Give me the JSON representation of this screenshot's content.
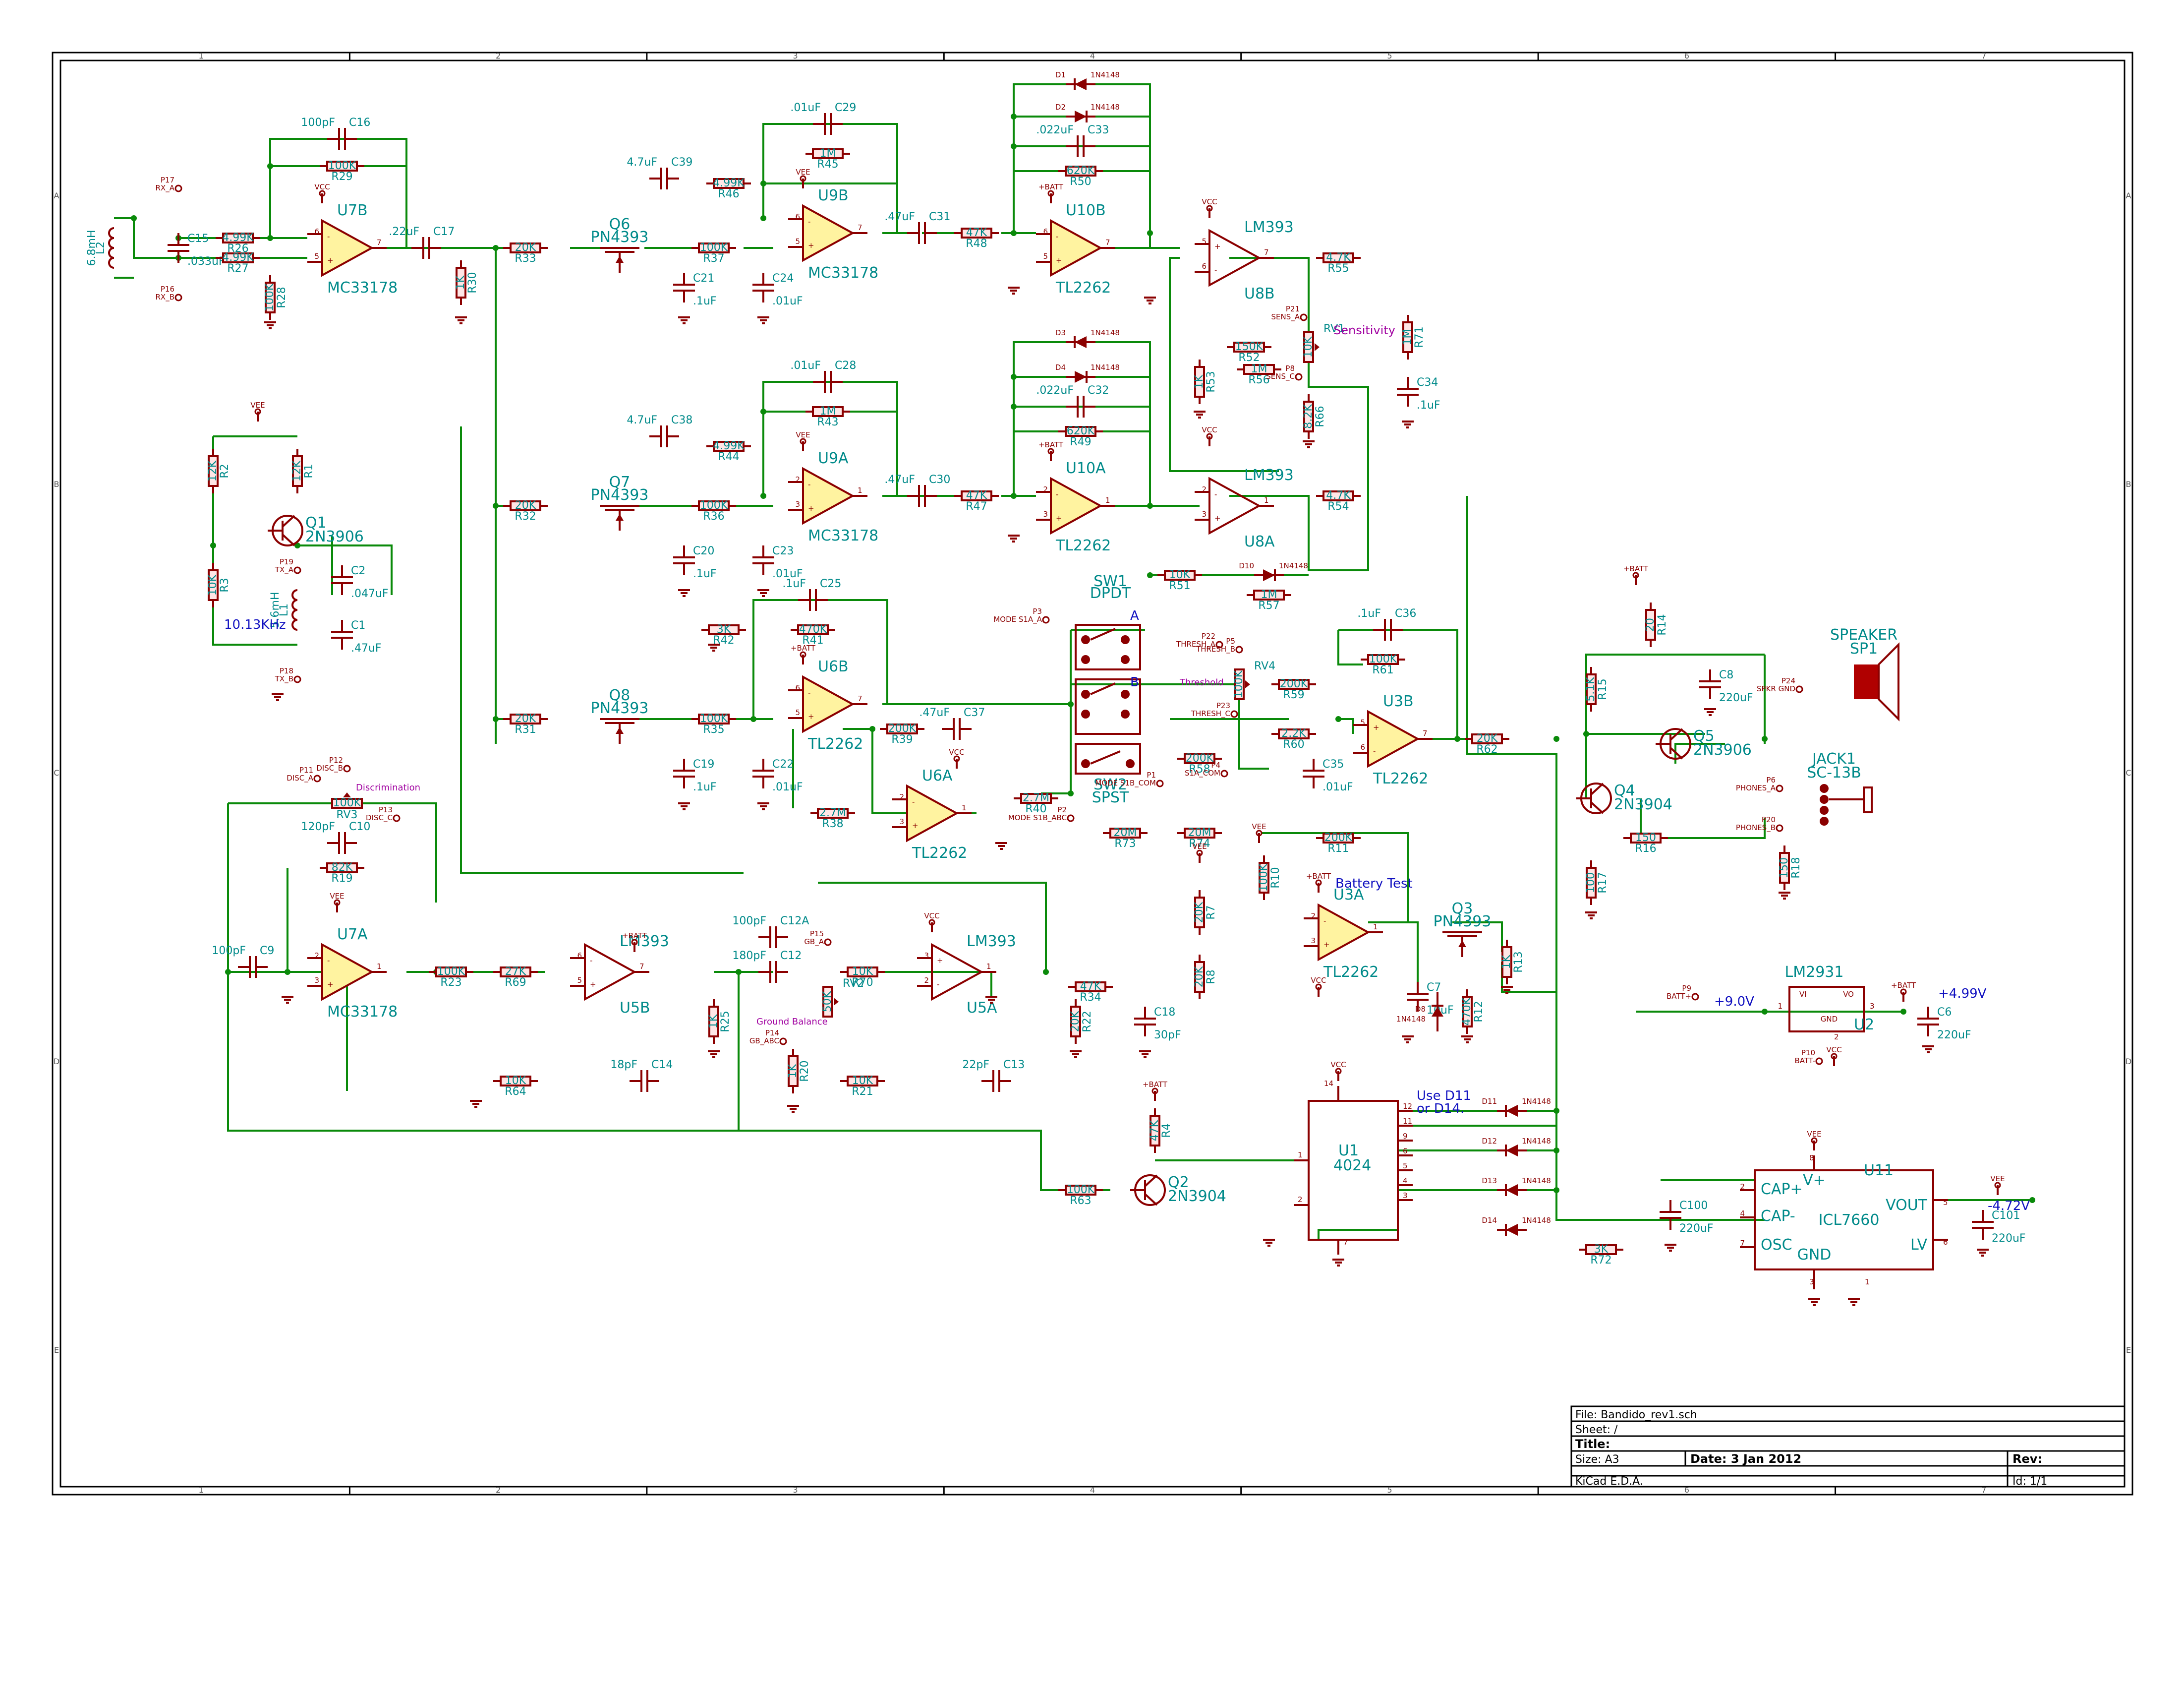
{
  "title_block": {
    "file": "File: Bandido_rev1.sch",
    "sheet": "Sheet: /",
    "title": "Title:",
    "size": "Size: A3",
    "date": "Date: 3 Jan 2012",
    "rev": "Rev:",
    "tool": "KiCad E.D.A.",
    "id": "Id: 1/1"
  },
  "frame": {
    "cols": [
      "1",
      "2",
      "3",
      "4",
      "5",
      "6",
      "7"
    ],
    "rows": [
      "A",
      "B",
      "C",
      "D",
      "E"
    ]
  },
  "annotations": {
    "freq": "10.13KHz",
    "battery_test": "Battery Test",
    "use_d11": "Use D11",
    "or_d14": "or D14.",
    "vbatt": "+9.0V",
    "v499": "+4.99V",
    "vneg": "-4.72V",
    "sensitivity": "Sensitivity",
    "threshold": "Threshold",
    "discrimination": "Discrimination",
    "ground_balance": "Ground Balance",
    "sw_a": "A",
    "sw_b": "B"
  },
  "opamps": [
    {
      "ref": "U7B",
      "val": "MC33178",
      "pin_in_top": "6",
      "pin_in_bot": "5",
      "pin_out": "7",
      "sign_top": "-",
      "sign_bot": "+"
    },
    {
      "ref": "U9B",
      "val": "MC33178",
      "pin_in_top": "6",
      "pin_in_bot": "5",
      "pin_out": "7",
      "sign_top": "-",
      "sign_bot": "+"
    },
    {
      "ref": "U10B",
      "val": "TL2262",
      "pin_in_top": "6",
      "pin_in_bot": "5",
      "pin_out": "7",
      "sign_top": "-",
      "sign_bot": "+"
    },
    {
      "ref": "U9A",
      "val": "MC33178",
      "pin_in_top": "2",
      "pin_in_bot": "3",
      "pin_out": "1",
      "sign_top": "-",
      "sign_bot": "+"
    },
    {
      "ref": "U10A",
      "val": "TL2262",
      "pin_in_top": "2",
      "pin_in_bot": "3",
      "pin_out": "1",
      "sign_top": "-",
      "sign_bot": "+"
    },
    {
      "ref": "U6B",
      "val": "TL2262",
      "pin_in_top": "6",
      "pin_in_bot": "5",
      "pin_out": "7",
      "sign_top": "-",
      "sign_bot": "+"
    },
    {
      "ref": "U6A",
      "val": "TL2262",
      "pin_in_top": "2",
      "pin_in_bot": "3",
      "pin_out": "1",
      "sign_top": "-",
      "sign_bot": "+"
    },
    {
      "ref": "U7A",
      "val": "MC33178",
      "pin_in_top": "2",
      "pin_in_bot": "3",
      "pin_out": "1",
      "sign_top": "-",
      "sign_bot": "+"
    },
    {
      "ref": "U3B",
      "val": "TL2262",
      "pin_in_top": "5",
      "pin_in_bot": "6",
      "pin_out": "7",
      "sign_top": "+",
      "sign_bot": "-"
    },
    {
      "ref": "U3A",
      "val": "TL2262",
      "pin_in_top": "2",
      "pin_in_bot": "3",
      "pin_out": "1",
      "sign_top": "-",
      "sign_bot": "+"
    }
  ],
  "comparators": [
    {
      "ref": "U8B",
      "val": "LM393",
      "pin_in_top": "5",
      "pin_in_bot": "6",
      "pin_out": "7",
      "sign_top": "+",
      "sign_bot": "-"
    },
    {
      "ref": "U8A",
      "val": "LM393",
      "pin_in_top": "2",
      "pin_in_bot": "3",
      "pin_out": "1",
      "sign_top": "-",
      "sign_bot": "+"
    },
    {
      "ref": "U5B",
      "val": "LM393",
      "pin_in_top": "6",
      "pin_in_bot": "5",
      "pin_out": "7",
      "sign_top": "-",
      "sign_bot": "+"
    },
    {
      "ref": "U5A",
      "val": "LM393",
      "pin_in_top": "3",
      "pin_in_bot": "2",
      "pin_out": "1",
      "sign_top": "+",
      "sign_bot": "-"
    }
  ],
  "resistors": [
    {
      "ref": "R26",
      "val": "4.99K"
    },
    {
      "ref": "R27",
      "val": "4.99K"
    },
    {
      "ref": "R29",
      "val": "100K"
    },
    {
      "ref": "R28",
      "val": "100K"
    },
    {
      "ref": "R30",
      "val": "1K"
    },
    {
      "ref": "R33",
      "val": "20K"
    },
    {
      "ref": "R37",
      "val": "100K"
    },
    {
      "ref": "R46",
      "val": "4.99K"
    },
    {
      "ref": "R45",
      "val": "1M"
    },
    {
      "ref": "R48",
      "val": "47K"
    },
    {
      "ref": "R50",
      "val": "620K"
    },
    {
      "ref": "R55",
      "val": "4.7K"
    },
    {
      "ref": "R52",
      "val": "150K"
    },
    {
      "ref": "R56",
      "val": "1M"
    },
    {
      "ref": "R53",
      "val": "1K"
    },
    {
      "ref": "R71",
      "val": "1M"
    },
    {
      "ref": "R66",
      "val": "8.2K"
    },
    {
      "ref": "R44",
      "val": "4.99K"
    },
    {
      "ref": "R43",
      "val": "1M"
    },
    {
      "ref": "R32",
      "val": "20K"
    },
    {
      "ref": "R36",
      "val": "100K"
    },
    {
      "ref": "R47",
      "val": "47K"
    },
    {
      "ref": "R49",
      "val": "620K"
    },
    {
      "ref": "R54",
      "val": "4.7K"
    },
    {
      "ref": "R51",
      "val": "10K"
    },
    {
      "ref": "R57",
      "val": "1M"
    },
    {
      "ref": "R2",
      "val": "12K"
    },
    {
      "ref": "R1",
      "val": "12K"
    },
    {
      "ref": "R3",
      "val": "10K"
    },
    {
      "ref": "R42",
      "val": "3K"
    },
    {
      "ref": "R41",
      "val": "470K"
    },
    {
      "ref": "R31",
      "val": "20K"
    },
    {
      "ref": "R35",
      "val": "100K"
    },
    {
      "ref": "R39",
      "val": "200K"
    },
    {
      "ref": "R38",
      "val": "2.7M"
    },
    {
      "ref": "R40",
      "val": "2.7M"
    },
    {
      "ref": "R73",
      "val": "20M"
    },
    {
      "ref": "R74",
      "val": "20M"
    },
    {
      "ref": "R58",
      "val": "200K"
    },
    {
      "ref": "R59",
      "val": "200K"
    },
    {
      "ref": "R60",
      "val": "2.2K"
    },
    {
      "ref": "R61",
      "val": "100K"
    },
    {
      "ref": "R62",
      "val": "20K"
    },
    {
      "ref": "R19",
      "val": "82K"
    },
    {
      "ref": "R23",
      "val": "100K"
    },
    {
      "ref": "R69",
      "val": "27K"
    },
    {
      "ref": "R25",
      "val": "1K"
    },
    {
      "ref": "R64",
      "val": "10K"
    },
    {
      "ref": "R70",
      "val": "10K"
    },
    {
      "ref": "R20",
      "val": "1K"
    },
    {
      "ref": "R21",
      "val": "10K"
    },
    {
      "ref": "R34",
      "val": "47K"
    },
    {
      "ref": "R22",
      "val": "20K"
    },
    {
      "ref": "R11",
      "val": "200K"
    },
    {
      "ref": "R10",
      "val": "100K"
    },
    {
      "ref": "R7",
      "val": "20K"
    },
    {
      "ref": "R8",
      "val": "20K"
    },
    {
      "ref": "R12",
      "val": "470K"
    },
    {
      "ref": "R13",
      "val": "1K"
    },
    {
      "ref": "R4",
      "val": "47K"
    },
    {
      "ref": "R63",
      "val": "100K"
    },
    {
      "ref": "R14",
      "val": "20"
    },
    {
      "ref": "R15",
      "val": "5.1K"
    },
    {
      "ref": "R16",
      "val": "150"
    },
    {
      "ref": "R17",
      "val": "100"
    },
    {
      "ref": "R18",
      "val": "150"
    },
    {
      "ref": "R72",
      "val": "3K"
    }
  ],
  "capacitors": [
    {
      "ref": "C16",
      "val": "100pF"
    },
    {
      "ref": "C15",
      "val": ".033uF"
    },
    {
      "ref": "C17",
      "val": ".22uF"
    },
    {
      "ref": "C21",
      "val": ".1uF"
    },
    {
      "ref": "C24",
      "val": ".01uF"
    },
    {
      "ref": "C39",
      "val": "4.7uF"
    },
    {
      "ref": "C29",
      "val": ".01uF"
    },
    {
      "ref": "C31",
      "val": ".47uF"
    },
    {
      "ref": "C33",
      "val": ".022uF"
    },
    {
      "ref": "C34",
      "val": ".1uF"
    },
    {
      "ref": "C38",
      "val": "4.7uF"
    },
    {
      "ref": "C28",
      "val": ".01uF"
    },
    {
      "ref": "C30",
      "val": ".47uF"
    },
    {
      "ref": "C32",
      "val": ".022uF"
    },
    {
      "ref": "C20",
      "val": ".1uF"
    },
    {
      "ref": "C23",
      "val": ".01uF"
    },
    {
      "ref": "C2",
      "val": ".047uF"
    },
    {
      "ref": "C1",
      "val": ".47uF"
    },
    {
      "ref": "C25",
      "val": ".1uF"
    },
    {
      "ref": "C19",
      "val": ".1uF"
    },
    {
      "ref": "C22",
      "val": ".01uF"
    },
    {
      "ref": "C37",
      "val": ".47uF"
    },
    {
      "ref": "C36",
      "val": ".1uF"
    },
    {
      "ref": "C35",
      "val": ".01uF"
    },
    {
      "ref": "C10",
      "val": "120pF"
    },
    {
      "ref": "C9",
      "val": "100pF"
    },
    {
      "ref": "C14",
      "val": "18pF"
    },
    {
      "ref": "C12A",
      "val": "100pF"
    },
    {
      "ref": "C12",
      "val": "180pF"
    },
    {
      "ref": "C13",
      "val": "22pF"
    },
    {
      "ref": "C18",
      "val": "30pF"
    },
    {
      "ref": "C7",
      "val": "10uF"
    },
    {
      "ref": "C8",
      "val": "220uF"
    },
    {
      "ref": "C6",
      "val": "220uF"
    },
    {
      "ref": "C100",
      "val": "220uF"
    },
    {
      "ref": "C101",
      "val": "220uF"
    }
  ],
  "diodes": [
    {
      "ref": "D1",
      "val": "1N4148"
    },
    {
      "ref": "D2",
      "val": "1N4148"
    },
    {
      "ref": "D3",
      "val": "1N4148"
    },
    {
      "ref": "D4",
      "val": "1N4148"
    },
    {
      "ref": "D10",
      "val": "1N4148"
    },
    {
      "ref": "D8",
      "val": "1N4148"
    },
    {
      "ref": "D11",
      "val": "1N4148"
    },
    {
      "ref": "D12",
      "val": "1N4148"
    },
    {
      "ref": "D13",
      "val": "1N4148"
    },
    {
      "ref": "D14",
      "val": "1N4148"
    }
  ],
  "transistors": [
    {
      "ref": "Q6",
      "val": "PN4393"
    },
    {
      "ref": "Q7",
      "val": "PN4393"
    },
    {
      "ref": "Q8",
      "val": "PN4393"
    },
    {
      "ref": "Q3",
      "val": "PN4393"
    },
    {
      "ref": "Q1",
      "val": "2N3906"
    },
    {
      "ref": "Q2",
      "val": "2N3904"
    },
    {
      "ref": "Q4",
      "val": "2N3904"
    },
    {
      "ref": "Q5",
      "val": "2N3906"
    }
  ],
  "inductors": [
    {
      "ref": "L2",
      "val": "6.8mH"
    },
    {
      "ref": "L1",
      "val": "5.6mH"
    }
  ],
  "pots": [
    {
      "ref": "RV1",
      "val": "10K"
    },
    {
      "ref": "RV4",
      "val": "100K"
    },
    {
      "ref": "RV3",
      "val": "100K"
    },
    {
      "ref": "RV2",
      "val": "50K"
    }
  ],
  "ics": [
    {
      "ref": "U1",
      "val": "4024",
      "pins_right": [
        "12",
        "11",
        "9",
        "6",
        "5",
        "4",
        "3"
      ],
      "pin_in": "1",
      "pin_top": "14",
      "pin_bot": "7",
      "pin_left2": "2"
    },
    {
      "ref": "U2",
      "val": "LM2931",
      "vi": "VI",
      "vo": "VO",
      "gnd": "GND",
      "p1": "1",
      "p2": "2",
      "p3": "3"
    },
    {
      "ref": "U11",
      "val": "ICL7660",
      "cap_p": "CAP+",
      "cap_n": "CAP-",
      "osc": "OSC",
      "vout": "VOUT",
      "lv": "LV",
      "gnd": "GND",
      "vplus": "V+",
      "p2": "2",
      "p4": "4",
      "p7": "7",
      "p5": "5",
      "p6": "6",
      "p3": "3",
      "p8": "8",
      "p1": "1"
    }
  ],
  "switches": [
    {
      "ref": "SW1",
      "val": "DPDT"
    },
    {
      "ref": "SW2",
      "val": "SPST"
    }
  ],
  "jacks": [
    {
      "ref": "JACK1",
      "val": "SC-13B"
    },
    {
      "ref": "SP1",
      "val": "SPEAKER"
    }
  ],
  "power": {
    "vcc": "VCC",
    "vee": "VEE",
    "batt": "+BATT",
    "batt_neg": "BATT-"
  },
  "test_points": [
    {
      "ref": "P17",
      "net": "RX_A"
    },
    {
      "ref": "P16",
      "net": "RX_B"
    },
    {
      "ref": "P19",
      "net": "TX_A"
    },
    {
      "ref": "P18",
      "net": "TX_B"
    },
    {
      "ref": "P21",
      "net": "SENS_A"
    },
    {
      "ref": "P8",
      "net": "SENS_C"
    },
    {
      "ref": "P3",
      "net": "MODE S1A_A"
    },
    {
      "ref": "P22",
      "net": "THRESH_A"
    },
    {
      "ref": "P5",
      "net": "THRESH_B"
    },
    {
      "ref": "P23",
      "net": "THRESH_C"
    },
    {
      "ref": "P4",
      "net": "S1A_COM"
    },
    {
      "ref": "P1",
      "net": "MODE S1B_COM"
    },
    {
      "ref": "P2",
      "net": "MODE S1B_ABC"
    },
    {
      "ref": "P11",
      "net": "DISC_A"
    },
    {
      "ref": "P12",
      "net": "DISC_B"
    },
    {
      "ref": "P13",
      "net": "DISC_C"
    },
    {
      "ref": "P15",
      "net": "GB_A"
    },
    {
      "ref": "P14",
      "net": "GB_ABC"
    },
    {
      "ref": "P24",
      "net": "SPKR GND"
    },
    {
      "ref": "P6",
      "net": "PHONES_A"
    },
    {
      "ref": "P20",
      "net": "PHONES_B"
    },
    {
      "ref": "P9",
      "net": "BATT+"
    },
    {
      "ref": "P10",
      "net": "BATT-"
    }
  ]
}
